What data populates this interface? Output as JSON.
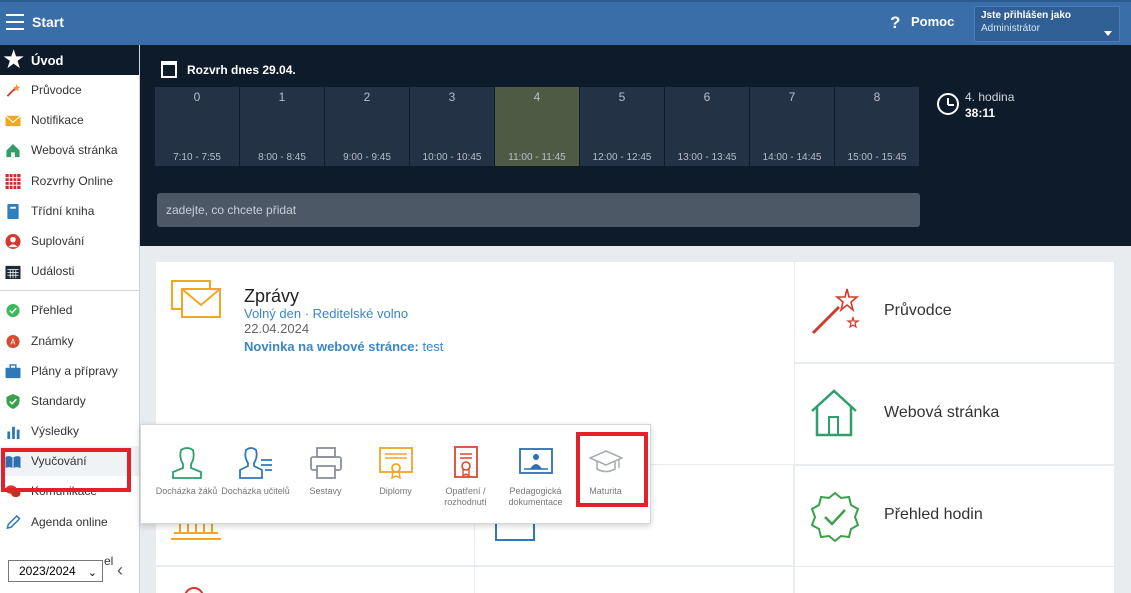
{
  "topbar": {
    "title": "Start",
    "help_label": "Pomoc",
    "help_icon": "question-icon",
    "user_line1": "Jste přihlášen jako",
    "user_line2": "Administrátor"
  },
  "sidebar": {
    "home": "Úvod",
    "items": [
      {
        "label": "Průvodce",
        "icon": "wand-icon"
      },
      {
        "label": "Notifikace",
        "icon": "envelope-icon"
      },
      {
        "label": "Webová stránka",
        "icon": "house-icon"
      },
      {
        "label": "Rozvrhy Online",
        "icon": "grid-icon"
      },
      {
        "label": "Třídní kniha",
        "icon": "book-icon"
      },
      {
        "label": "Suplování",
        "icon": "person-icon"
      },
      {
        "label": "Události",
        "icon": "calendar-icon"
      }
    ],
    "items2": [
      {
        "label": "Přehled",
        "icon": "check-circle-icon"
      },
      {
        "label": "Známky",
        "icon": "grade-icon"
      },
      {
        "label": "Plány a přípravy",
        "icon": "briefcase-icon"
      },
      {
        "label": "Standardy",
        "icon": "shield-icon"
      },
      {
        "label": "Výsledky",
        "icon": "bar-chart-icon"
      },
      {
        "label": "Vyučování",
        "icon": "open-book-icon"
      },
      {
        "label": "Komunikace",
        "icon": "chat-icon"
      },
      {
        "label": "Agenda online",
        "icon": "pen-icon"
      }
    ],
    "hidden_partial": "el",
    "year": "2023/2024"
  },
  "schedule": {
    "title": "Rozvrh dnes 29.04.",
    "periods": [
      {
        "num": "0",
        "time": "7:10 - 7:55"
      },
      {
        "num": "1",
        "time": "8:00 - 8:45"
      },
      {
        "num": "2",
        "time": "9:00 - 9:45"
      },
      {
        "num": "3",
        "time": "10:00 - 10:45"
      },
      {
        "num": "4",
        "time": "11:00 - 11:45"
      },
      {
        "num": "5",
        "time": "12:00 - 12:45"
      },
      {
        "num": "6",
        "time": "13:00 - 13:45"
      },
      {
        "num": "7",
        "time": "14:00 - 14:45"
      },
      {
        "num": "8",
        "time": "15:00 - 15:45"
      }
    ],
    "current_index": 4,
    "hour_label": "4. hodina",
    "remaining": "38:11",
    "add_placeholder": "zadejte, co chcete přidat"
  },
  "messages": {
    "title": "Zprávy",
    "line1": "Volný den · Reditelské volno",
    "date": "22.04.2024",
    "news_label": "Novinka na webové stránce:",
    "news_value": "test"
  },
  "tiles": [
    {
      "label": "Průvodce",
      "icon": "wand-icon"
    },
    {
      "label": "Webová stránka",
      "icon": "house-icon"
    },
    {
      "label": "Přehled hodin",
      "icon": "check-badge-icon"
    }
  ],
  "popup": {
    "items": [
      {
        "label": "Docházka žáků",
        "icon": "student-icon"
      },
      {
        "label": "Docházka učitelů",
        "icon": "teacher-list-icon"
      },
      {
        "label": "Sestavy",
        "icon": "printer-icon"
      },
      {
        "label": "Diplomy",
        "icon": "diploma-icon"
      },
      {
        "label": "Opatření / rozhodnutí",
        "icon": "document-seal-icon"
      },
      {
        "label": "Pedagogická dokumentace",
        "icon": "board-icon"
      },
      {
        "label": "Maturita",
        "icon": "graduation-cap-icon"
      }
    ]
  },
  "colors": {
    "topbar": "#3a6ea8",
    "dark": "#0e1b2a",
    "period": "#243245",
    "period_current": "#4f5a45",
    "highlight": "#e2212b",
    "link": "#3a86c8"
  }
}
